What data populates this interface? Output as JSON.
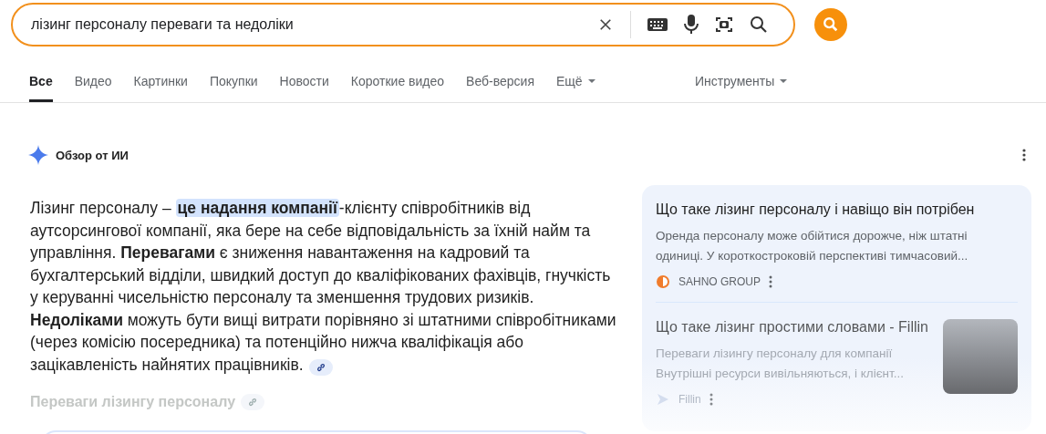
{
  "search": {
    "value": "лізинг персоналу переваги та недоліки"
  },
  "tabs": [
    {
      "label": "Все",
      "selected": true
    },
    {
      "label": "Видео",
      "selected": false
    },
    {
      "label": "Картинки",
      "selected": false
    },
    {
      "label": "Покупки",
      "selected": false
    },
    {
      "label": "Новости",
      "selected": false
    },
    {
      "label": "Короткие видео",
      "selected": false
    },
    {
      "label": "Веб-версия",
      "selected": false
    },
    {
      "label": "Ещё",
      "selected": false,
      "kind": "menu"
    }
  ],
  "tools": "Инструменты",
  "ai_overview": {
    "title": "Обзор от ИИ",
    "paragraph": [
      {
        "kind": "plain",
        "text": "Лізинг персоналу – "
      },
      {
        "kind": "highlight",
        "text": "це надання компанії"
      },
      {
        "kind": "plain",
        "text": "-клієнту співробітників від аутсорсингової компанії, яка бере на себе відповідальність за їхній найм та управління. "
      },
      {
        "kind": "bold",
        "text": "Перевагами"
      },
      {
        "kind": "plain",
        "text": " є зниження навантаження на кадровий та бухгалтерський відділи, швидкий доступ до кваліфікованих фахівців, гнучкість у керуванні чисельністю персоналу та зменшення трудових ризиків. "
      },
      {
        "kind": "bold",
        "text": "Недоліками"
      },
      {
        "kind": "plain",
        "text": " можуть бути вищі витрати порівняно зі штатними співробітниками (через комісію посередника) та потенційно нижча кваліфікація або зацікавленість найнятих працівників."
      }
    ],
    "subheading": "Переваги лізингу персоналу",
    "sources": [
      {
        "title": "Що таке лізинг персоналу і навіщо він потрібен",
        "snippet": "Оренда персоналу може обійтися дорожче, ніж штатні одиниці. У короткостроковій перспективі тимчасовий...",
        "site": "SAHNO GROUP",
        "thumbnail": false
      },
      {
        "title": "Що таке лізинг простими словами - Fillin",
        "snippet": "Переваги лізингу персоналу для компанії Внутрішні ресурси вивільняються, і клієнт...",
        "site": "Fillin",
        "thumbnail": true
      }
    ]
  }
}
